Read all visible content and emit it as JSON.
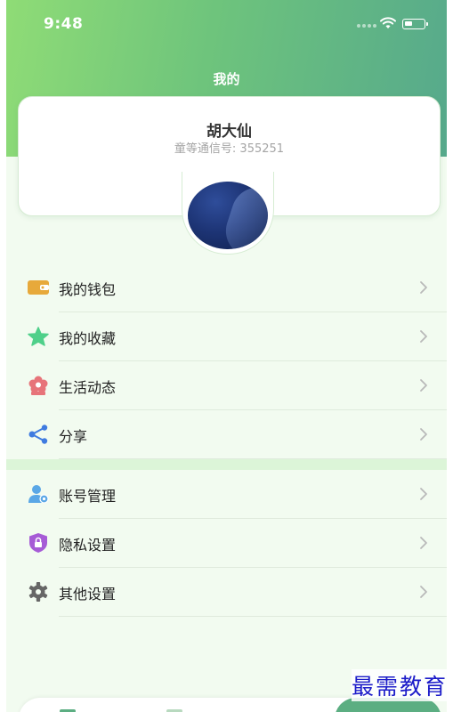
{
  "status_bar": {
    "time": "9:48"
  },
  "header": {
    "title": "我的"
  },
  "profile": {
    "name": "胡大仙",
    "id_line": "童等通信号: 355251"
  },
  "menu_group_1": [
    {
      "label": "我的钱包",
      "icon": "wallet-icon"
    },
    {
      "label": "我的收藏",
      "icon": "star-icon"
    },
    {
      "label": "生活动态",
      "icon": "flower-icon"
    },
    {
      "label": "分享",
      "icon": "share-icon"
    }
  ],
  "menu_group_2": [
    {
      "label": "账号管理",
      "icon": "user-gear-icon"
    },
    {
      "label": "隐私设置",
      "icon": "lock-shield-icon"
    },
    {
      "label": "其他设置",
      "icon": "gear-icon"
    }
  ],
  "watermark": "最需教育",
  "colors": {
    "header_start": "#8fdc76",
    "header_end": "#56a98c",
    "wallet": "#e7a93b",
    "star": "#4fd08a",
    "flower": "#e7747a",
    "share": "#3f7be0",
    "user": "#5aa7e6",
    "lock": "#a65bd6",
    "gear": "#666666"
  }
}
